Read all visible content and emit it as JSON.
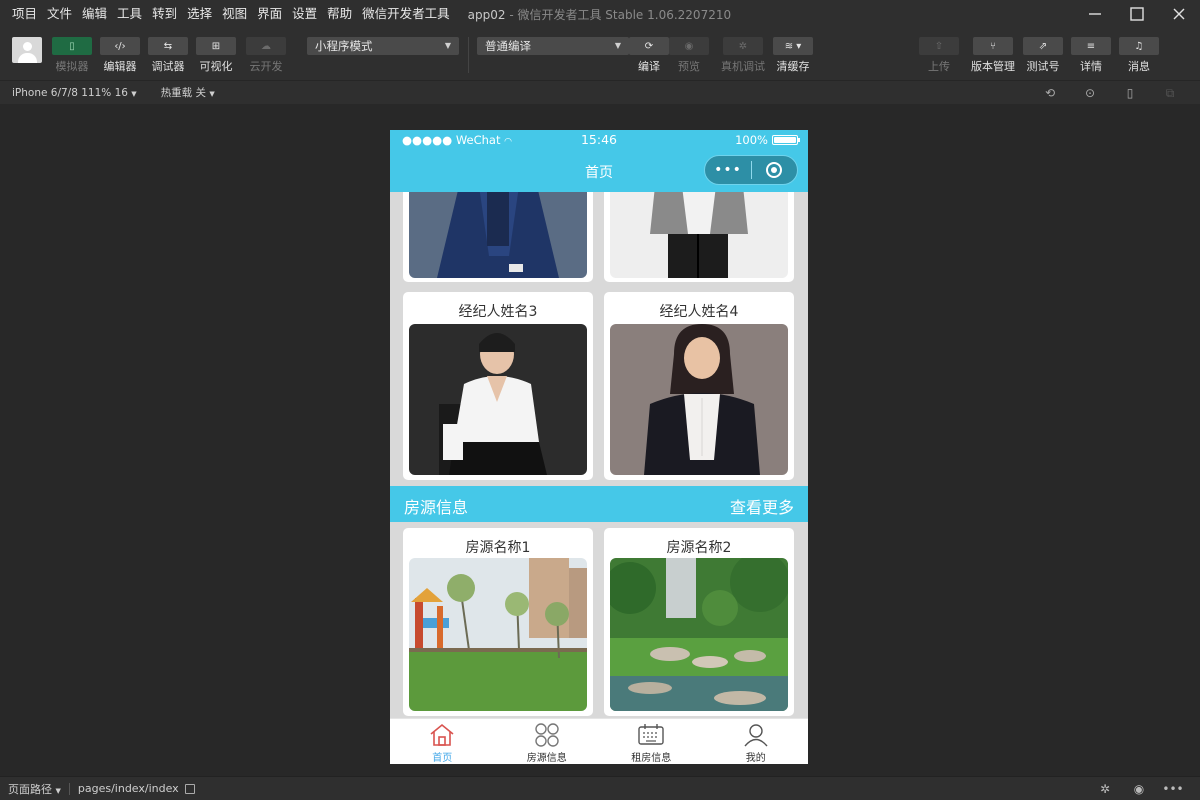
{
  "menubar": {
    "items": [
      "项目",
      "文件",
      "编辑",
      "工具",
      "转到",
      "选择",
      "视图",
      "界面",
      "设置",
      "帮助",
      "微信开发者工具"
    ],
    "app_name": "app02",
    "window_title": " - 微信开发者工具 Stable 1.06.2207210"
  },
  "toolbar": {
    "simulator": "模拟器",
    "editor": "编辑器",
    "debugger": "调试器",
    "visual": "可视化",
    "cloud": "云开发",
    "mode_select": "小程序模式",
    "compile_select": "普通编译",
    "compile": "编译",
    "preview": "预览",
    "real_debug": "真机调试",
    "clear_cache": "清缓存",
    "upload": "上传",
    "version": "版本管理",
    "test_account": "测试号",
    "details": "详情",
    "messages": "消息"
  },
  "subbar": {
    "device": "iPhone 6/7/8 111% 16",
    "hot_reload": "热重载 关"
  },
  "phone": {
    "carrier": "●●●●● WeChat",
    "time": "15:46",
    "battery": "100%",
    "nav_title": "首页",
    "capsule_dots": "•••",
    "agents": [
      {
        "name": "经纪人姓名3"
      },
      {
        "name": "经纪人姓名4"
      }
    ],
    "section": {
      "title": "房源信息",
      "more": "查看更多"
    },
    "houses": [
      {
        "name": "房源名称1"
      },
      {
        "name": "房源名称2"
      }
    ],
    "tabs": [
      {
        "label": "首页",
        "icon": "home-icon"
      },
      {
        "label": "房源信息",
        "icon": "grid-icon"
      },
      {
        "label": "租房信息",
        "icon": "keyboard-icon"
      },
      {
        "label": "我的",
        "icon": "user-icon"
      }
    ]
  },
  "footer": {
    "path_label": "页面路径",
    "path_value": "pages/index/index"
  },
  "colors": {
    "accent": "#45c8e8",
    "tab_active": "#45a8e8",
    "ide_bg": "#2b2b2b"
  }
}
